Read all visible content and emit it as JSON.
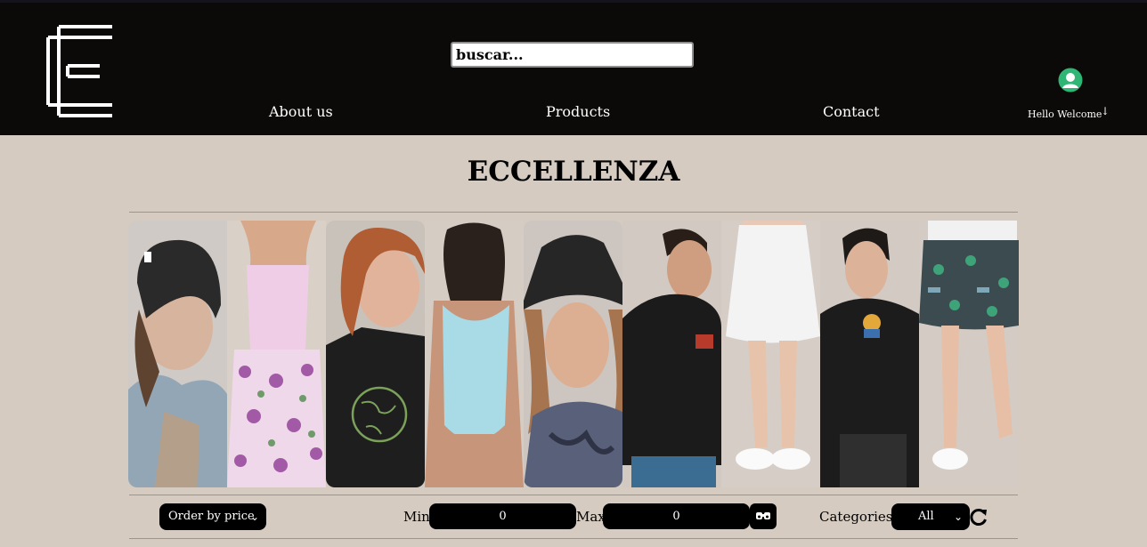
{
  "header": {
    "logo_name": "eccellenza-logo",
    "search": {
      "placeholder": "buscar..."
    },
    "nav": [
      {
        "label": "About us"
      },
      {
        "label": "Products"
      },
      {
        "label": "Contact"
      }
    ],
    "user": {
      "greeting": "Hello Welcome",
      "menu_icon": "arrow-down-icon",
      "avatar_icon": "user-avatar-icon"
    }
  },
  "main": {
    "title": "ECCELLENZA"
  },
  "gallery": {
    "photos": [
      {
        "label": "woman-beanie"
      },
      {
        "label": "pink-tank-floral-skirt"
      },
      {
        "label": "woman-earth-tee"
      },
      {
        "label": "blue-swimsuit"
      },
      {
        "label": "woman-bucket-hat"
      },
      {
        "label": "man-polo"
      },
      {
        "label": "white-skirt"
      },
      {
        "label": "man-longsleeve"
      },
      {
        "label": "paw-print-skirt"
      }
    ]
  },
  "filters": {
    "order": {
      "selected": "Order by price"
    },
    "min": {
      "label": "Min",
      "value": "0"
    },
    "max": {
      "label": "Max",
      "value": "0"
    },
    "categories": {
      "label": "Categories:",
      "selected": "All"
    }
  },
  "colors": {
    "header_bg": "#0c0a08",
    "page_bg": "#d5cbc1",
    "accent_green": "#2fb574"
  }
}
